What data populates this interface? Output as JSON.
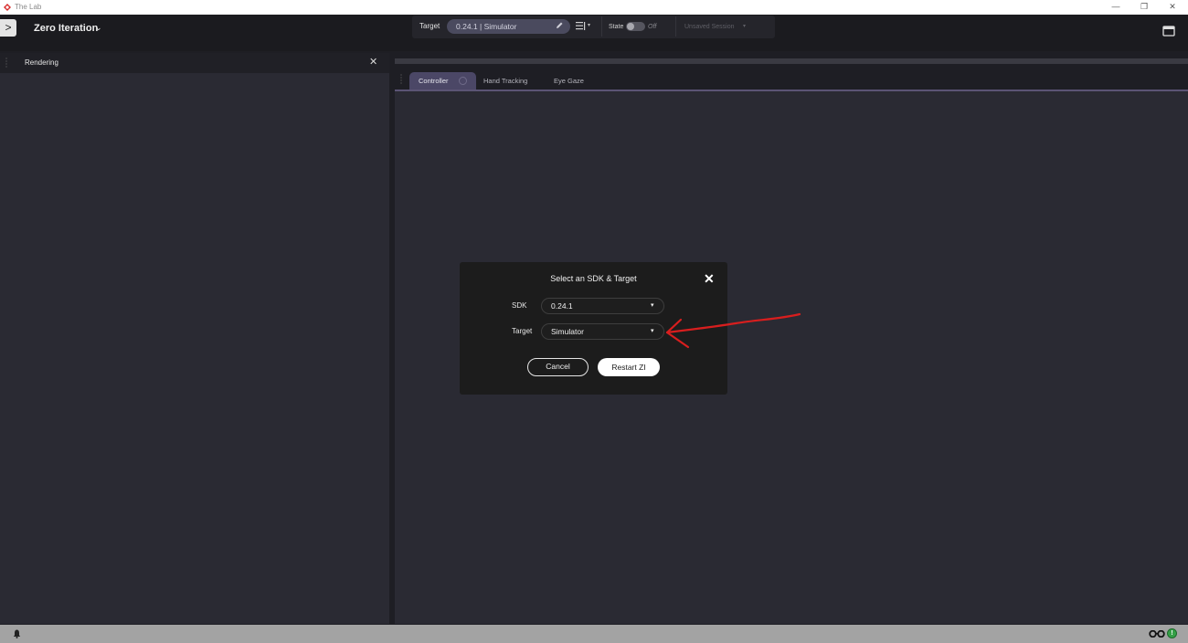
{
  "window": {
    "title": "The Lab",
    "minimize_glyph": "—",
    "restore_glyph": "❐",
    "close_glyph": "✕"
  },
  "header": {
    "sidebar_toggle_glyph": ">",
    "app_name": "Zero Iteration",
    "app_name_chevron": "⌄"
  },
  "toolbar": {
    "target_label": "Target",
    "target_value": "0.24.1 | Simulator",
    "list_caret": "▾",
    "state_label": "State",
    "state_value": "Off",
    "session_label": "Unsaved Session",
    "session_caret": "▾"
  },
  "left_panel": {
    "title": "Rendering",
    "close_glyph": "✕"
  },
  "tabs": [
    {
      "label": "Controller",
      "active": true
    },
    {
      "label": "Hand Tracking",
      "active": false
    },
    {
      "label": "Eye Gaze",
      "active": false
    }
  ],
  "dialog": {
    "title": "Select an SDK & Target",
    "close_glyph": "✕",
    "sdk_label": "SDK",
    "sdk_value": "0.24.1",
    "target_label": "Target",
    "target_value": "Simulator",
    "caret": "▾",
    "cancel_label": "Cancel",
    "restart_label": "Restart ZI"
  },
  "statusbar": {
    "status_dot_glyph": "!"
  },
  "colors": {
    "accent": "#4b4766",
    "annotation": "#d81e1e",
    "status_ok": "#35a047"
  },
  "icons": [
    "app-logo-icon",
    "edit-icon",
    "list-icon",
    "layout-icon",
    "bell-icon",
    "goggles-icon",
    "close-icon",
    "caret-down-icon"
  ]
}
